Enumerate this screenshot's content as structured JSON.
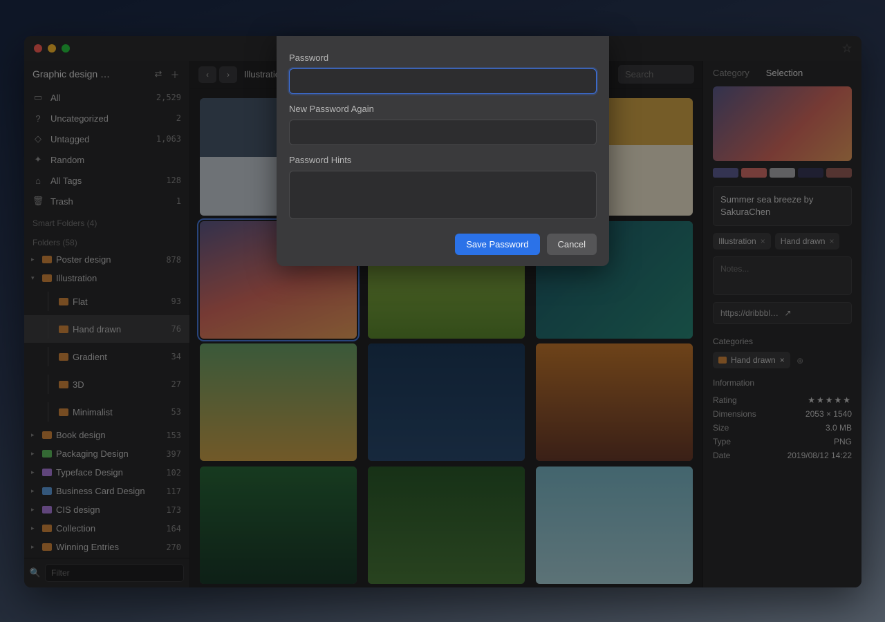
{
  "library_name": "Graphic design …",
  "smart_folders_label": "Smart Folders (4)",
  "folders_label": "Folders (58)",
  "sidebar": {
    "all": {
      "label": "All",
      "count": "2,529"
    },
    "uncat": {
      "label": "Uncategorized",
      "count": "2"
    },
    "untagged": {
      "label": "Untagged",
      "count": "1,063"
    },
    "random": {
      "label": "Random",
      "count": ""
    },
    "alltags": {
      "label": "All Tags",
      "count": "128"
    },
    "trash": {
      "label": "Trash",
      "count": "1"
    }
  },
  "folders": [
    {
      "name": "Poster design",
      "count": "878",
      "color": "#d88b3f",
      "expanded": false,
      "depth": 0
    },
    {
      "name": "Illustration",
      "count": "",
      "color": "#d88b3f",
      "expanded": true,
      "depth": 0
    },
    {
      "name": "Flat",
      "count": "93",
      "color": "#d88b3f",
      "depth": 1
    },
    {
      "name": "Hand drawn",
      "count": "76",
      "color": "#d88b3f",
      "depth": 1,
      "selected": true
    },
    {
      "name": "Gradient",
      "count": "34",
      "color": "#d88b3f",
      "depth": 1
    },
    {
      "name": "3D",
      "count": "27",
      "color": "#d88b3f",
      "depth": 1
    },
    {
      "name": "Minimalist",
      "count": "53",
      "color": "#d88b3f",
      "depth": 1
    },
    {
      "name": "Book design",
      "count": "153",
      "color": "#d88b3f",
      "depth": 0
    },
    {
      "name": "Packaging Design",
      "count": "397",
      "color": "#5fbf5f",
      "depth": 0
    },
    {
      "name": "Typeface Design",
      "count": "102",
      "color": "#b07fe0",
      "depth": 0
    },
    {
      "name": "Business Card Design",
      "count": "117",
      "color": "#5f9fe0",
      "depth": 0
    },
    {
      "name": "CIS design",
      "count": "173",
      "color": "#b07fe0",
      "depth": 0
    },
    {
      "name": "Collection",
      "count": "164",
      "color": "#d88b3f",
      "depth": 0
    },
    {
      "name": "Winning Entries",
      "count": "270",
      "color": "#d88b3f",
      "depth": 0
    }
  ],
  "filter_placeholder": "Filter",
  "breadcrumb": "Illustration",
  "search_placeholder": "Search",
  "inspector": {
    "tabs": {
      "category": "Category",
      "selection": "Selection"
    },
    "swatches": [
      "#5f5f95",
      "#d6706a",
      "#b0b0b2",
      "#3a3a5a",
      "#9a5f5a"
    ],
    "title": "Summer sea breeze by SakuraChen",
    "tags": [
      "Illustration",
      "Hand drawn"
    ],
    "notes_placeholder": "Notes...",
    "url": "https://dribbble.com/sa",
    "categories_label": "Categories",
    "category_chip": "Hand drawn",
    "info_label": "Information",
    "info": {
      "rating_label": "Rating",
      "dimensions_label": "Dimensions",
      "dimensions": "2053 × 1540",
      "size_label": "Size",
      "size": "3.0 MB",
      "type_label": "Type",
      "type": "PNG",
      "date_label": "Date",
      "date": "2019/08/12 14:22"
    }
  },
  "modal": {
    "password_label": "Password",
    "again_label": "New Password Again",
    "hints_label": "Password Hints",
    "save": "Save Password",
    "cancel": "Cancel"
  }
}
